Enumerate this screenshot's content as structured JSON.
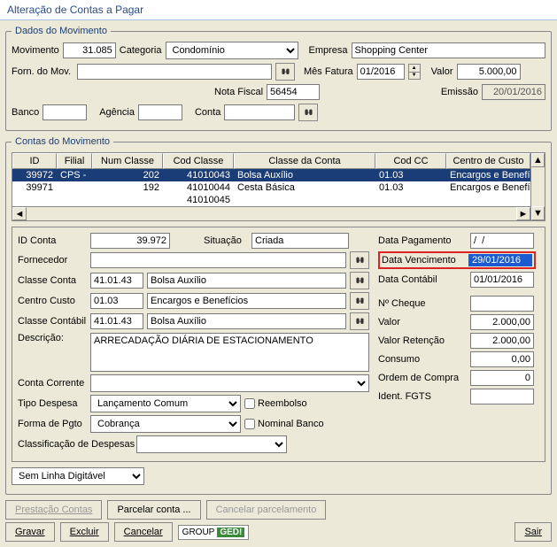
{
  "title": "Alteração de Contas a Pagar",
  "dados": {
    "legend": "Dados do Movimento",
    "movimento_lbl": "Movimento",
    "movimento": "31.085",
    "categoria_lbl": "Categoria",
    "categoria": "Condomínio",
    "empresa_lbl": "Empresa",
    "empresa": "Shopping Center",
    "forn_lbl": "Forn. do Mov.",
    "forn": "",
    "mes_fatura_lbl": "Mês Fatura",
    "mes_fatura": "01/2016",
    "valor_lbl": "Valor",
    "valor": "5.000,00",
    "nota_fiscal_lbl": "Nota Fiscal",
    "nota_fiscal": "56454",
    "emissao_lbl": "Emissão",
    "emissao": "20/01/2016",
    "banco_lbl": "Banco",
    "banco": "",
    "agencia_lbl": "Agência",
    "agencia": "",
    "conta_lbl": "Conta",
    "conta": ""
  },
  "contas_legend": "Contas do Movimento",
  "grid": {
    "headers": [
      "ID",
      "Filial",
      "Num Classe",
      "Cod Classe",
      "Classe da Conta",
      "Cod CC",
      "Centro de Custo"
    ],
    "rows": [
      {
        "id": "39972",
        "filial": "CPS -",
        "num": "202",
        "cod": "41010043",
        "classe": "Bolsa Auxílio",
        "cc": "01.03",
        "centro": "Encargos e Benefícios",
        "selected": true
      },
      {
        "id": "39971",
        "filial": "",
        "num": "192",
        "cod": "41010044",
        "classe": "Cesta Básica",
        "cc": "01.03",
        "centro": "Encargos e Benefícios",
        "selected": false
      },
      {
        "id": "",
        "filial": "",
        "num": "",
        "cod": "41010045",
        "classe": "",
        "cc": "",
        "centro": "",
        "selected": false
      }
    ]
  },
  "detail": {
    "id_conta_lbl": "ID Conta",
    "id_conta": "39.972",
    "situacao_lbl": "Situação",
    "situacao": "Criada",
    "fornecedor_lbl": "Fornecedor",
    "fornecedor": "",
    "classe_conta_lbl": "Classe Conta",
    "classe_conta_cod": "41.01.43",
    "classe_conta_desc": "Bolsa Auxílio",
    "centro_custo_lbl": "Centro Custo",
    "centro_custo_cod": "01.03",
    "centro_custo_desc": "Encargos e Benefícios",
    "classe_contabil_lbl": "Classe Contábil",
    "classe_contabil_cod": "41.01.43",
    "classe_contabil_desc": "Bolsa Auxílio",
    "descricao_lbl": "Descrição:",
    "descricao": "ARRECADAÇÃO DIÁRIA DE ESTACIONAMENTO",
    "conta_corrente_lbl": "Conta Corrente",
    "conta_corrente": "",
    "tipo_despesa_lbl": "Tipo Despesa",
    "tipo_despesa": "Lançamento Comum",
    "forma_pgto_lbl": "Forma de Pgto",
    "forma_pgto": "Cobrança",
    "reembolso_lbl": "Reembolso",
    "nominal_lbl": "Nominal Banco",
    "classif_lbl": "Classificação de Despesas",
    "classif": "",
    "data_pagto_lbl": "Data Pagamento",
    "data_pagto": "/  /",
    "data_venc_lbl": "Data Vencimento",
    "data_venc": "29/01/2016",
    "data_contabil_lbl": "Data Contábil",
    "data_contabil": "01/01/2016",
    "n_cheque_lbl": "Nº Cheque",
    "n_cheque": "",
    "valor_lbl": "Valor",
    "valor": "2.000,00",
    "valor_ret_lbl": "Valor Retenção",
    "valor_ret": "2.000,00",
    "consumo_lbl": "Consumo",
    "consumo": "0,00",
    "ordem_lbl": "Ordem de Compra",
    "ordem": "0",
    "ident_lbl": "Ident. FGTS",
    "ident": ""
  },
  "linha": {
    "label": "Sem Linha Digitável"
  },
  "buttons": {
    "prestacao": "Prestação Contas",
    "parcelar": "Parcelar conta ...",
    "cancelar_parcel": "Cancelar parcelamento",
    "gravar": "Gravar",
    "excluir": "Excluir",
    "cancelar": "Cancelar",
    "sair": "Sair",
    "group": "GROUP",
    "ged": "GED!"
  }
}
